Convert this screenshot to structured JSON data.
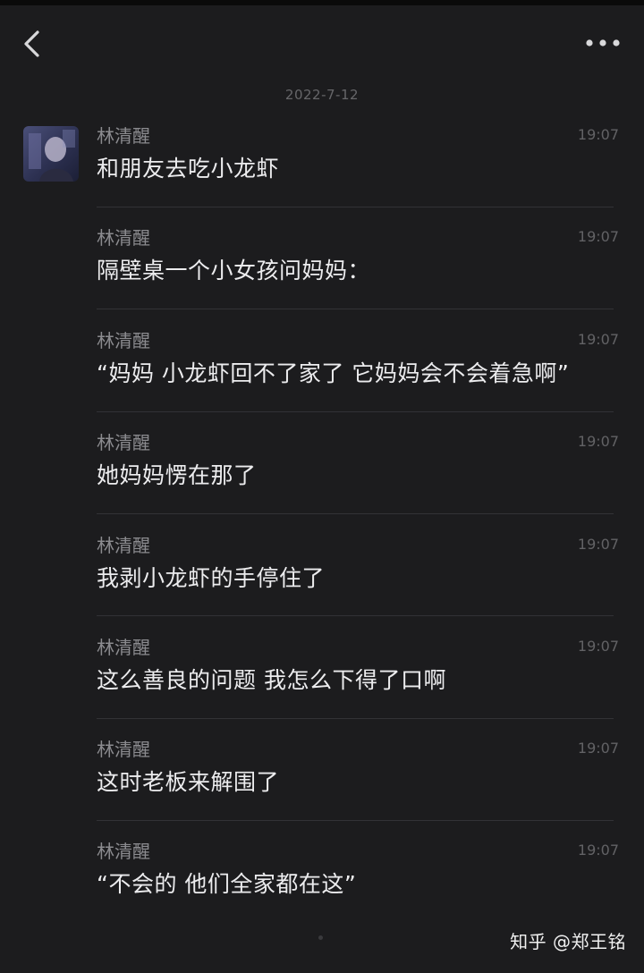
{
  "header": {
    "back_icon": "chevron-left-icon",
    "more_icon": "more-horizontal-icon"
  },
  "date_separator": "2022-7-12",
  "messages": [
    {
      "sender": "林清醒",
      "time": "19:07",
      "text": "和朋友去吃小龙虾"
    },
    {
      "sender": "林清醒",
      "time": "19:07",
      "text": "隔壁桌一个小女孩问妈妈："
    },
    {
      "sender": "林清醒",
      "time": "19:07",
      "text": "“妈妈 小龙虾回不了家了 它妈妈会不会着急啊”"
    },
    {
      "sender": "林清醒",
      "time": "19:07",
      "text": "她妈妈愣在那了"
    },
    {
      "sender": "林清醒",
      "time": "19:07",
      "text": "我剥小龙虾的手停住了"
    },
    {
      "sender": "林清醒",
      "time": "19:07",
      "text": "这么善良的问题 我怎么下得了口啊"
    },
    {
      "sender": "林清醒",
      "time": "19:07",
      "text": "这时老板来解围了"
    },
    {
      "sender": "林清醒",
      "time": "19:07",
      "text": "“不会的 他们全家都在这”"
    }
  ],
  "watermark": "知乎 @郑王铭",
  "colors": {
    "background": "#1c1c1e",
    "message_text": "#ececee",
    "sender_text": "#8b8b8f",
    "time_text": "#626265"
  }
}
